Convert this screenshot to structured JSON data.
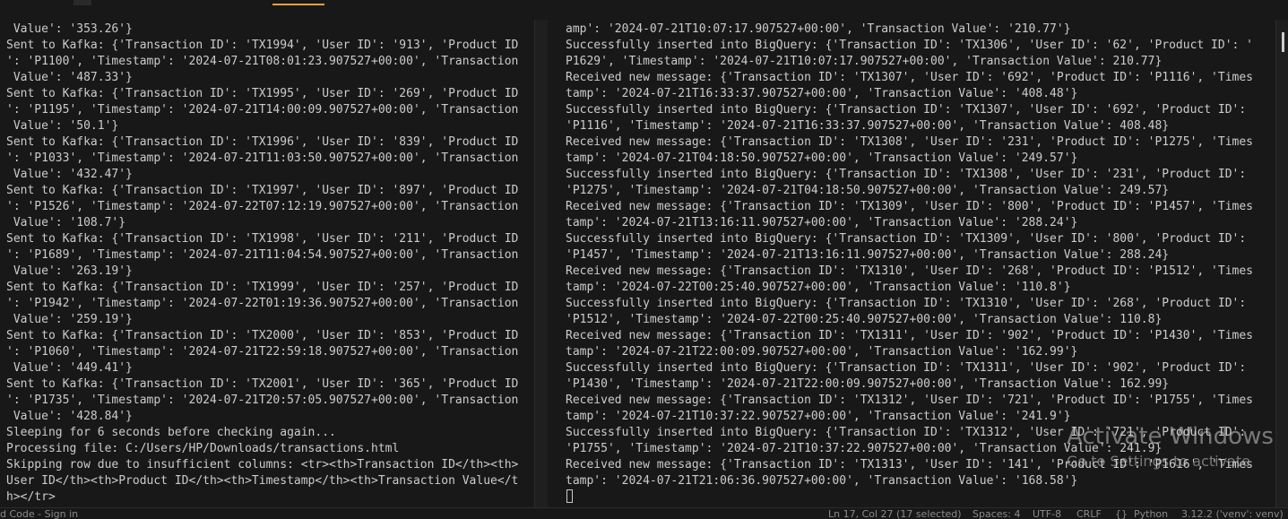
{
  "left_terminal": {
    "lines": [
      " Value': '353.26'}",
      "Sent to Kafka: {'Transaction ID': 'TX1994', 'User ID': '913', 'Product ID",
      "': 'P1100', 'Timestamp': '2024-07-21T08:01:23.907527+00:00', 'Transaction",
      " Value': '487.33'}",
      "Sent to Kafka: {'Transaction ID': 'TX1995', 'User ID': '269', 'Product ID",
      "': 'P1195', 'Timestamp': '2024-07-21T14:00:09.907527+00:00', 'Transaction",
      " Value': '50.1'}",
      "Sent to Kafka: {'Transaction ID': 'TX1996', 'User ID': '839', 'Product ID",
      "': 'P1033', 'Timestamp': '2024-07-21T11:03:50.907527+00:00', 'Transaction",
      " Value': '432.47'}",
      "Sent to Kafka: {'Transaction ID': 'TX1997', 'User ID': '897', 'Product ID",
      "': 'P1526', 'Timestamp': '2024-07-22T07:12:19.907527+00:00', 'Transaction",
      " Value': '108.7'}",
      "Sent to Kafka: {'Transaction ID': 'TX1998', 'User ID': '211', 'Product ID",
      "': 'P1689', 'Timestamp': '2024-07-21T11:04:54.907527+00:00', 'Transaction",
      " Value': '263.19'}",
      "Sent to Kafka: {'Transaction ID': 'TX1999', 'User ID': '257', 'Product ID",
      "': 'P1942', 'Timestamp': '2024-07-22T01:19:36.907527+00:00', 'Transaction",
      " Value': '259.19'}",
      "Sent to Kafka: {'Transaction ID': 'TX2000', 'User ID': '853', 'Product ID",
      "': 'P1060', 'Timestamp': '2024-07-21T22:59:18.907527+00:00', 'Transaction",
      " Value': '449.41'}",
      "Sent to Kafka: {'Transaction ID': 'TX2001', 'User ID': '365', 'Product ID",
      "': 'P1735', 'Timestamp': '2024-07-21T20:57:05.907527+00:00', 'Transaction",
      " Value': '428.84'}",
      "Sleeping for 6 seconds before checking again...",
      "Processing file: C:/Users/HP/Downloads/transactions.html",
      "Skipping row due to insufficient columns: <tr><th>Transaction ID</th><th>",
      "User ID</th><th>Product ID</th><th>Timestamp</th><th>Transaction Value</t",
      "h></tr>"
    ]
  },
  "right_terminal": {
    "lines": [
      "amp': '2024-07-21T10:07:17.907527+00:00', 'Transaction Value': '210.77'}",
      "Successfully inserted into BigQuery: {'Transaction ID': 'TX1306', 'User ID': '62', 'Product ID': '",
      "P1629', 'Timestamp': '2024-07-21T10:07:17.907527+00:00', 'Transaction Value': 210.77}",
      "Received new message: {'Transaction ID': 'TX1307', 'User ID': '692', 'Product ID': 'P1116', 'Times",
      "tamp': '2024-07-21T16:33:37.907527+00:00', 'Transaction Value': '408.48'}",
      "Successfully inserted into BigQuery: {'Transaction ID': 'TX1307', 'User ID': '692', 'Product ID':",
      "'P1116', 'Timestamp': '2024-07-21T16:33:37.907527+00:00', 'Transaction Value': 408.48}",
      "Received new message: {'Transaction ID': 'TX1308', 'User ID': '231', 'Product ID': 'P1275', 'Times",
      "tamp': '2024-07-21T04:18:50.907527+00:00', 'Transaction Value': '249.57'}",
      "Successfully inserted into BigQuery: {'Transaction ID': 'TX1308', 'User ID': '231', 'Product ID':",
      "'P1275', 'Timestamp': '2024-07-21T04:18:50.907527+00:00', 'Transaction Value': 249.57}",
      "Received new message: {'Transaction ID': 'TX1309', 'User ID': '800', 'Product ID': 'P1457', 'Times",
      "tamp': '2024-07-21T13:16:11.907527+00:00', 'Transaction Value': '288.24'}",
      "Successfully inserted into BigQuery: {'Transaction ID': 'TX1309', 'User ID': '800', 'Product ID':",
      "'P1457', 'Timestamp': '2024-07-21T13:16:11.907527+00:00', 'Transaction Value': 288.24}",
      "Received new message: {'Transaction ID': 'TX1310', 'User ID': '268', 'Product ID': 'P1512', 'Times",
      "tamp': '2024-07-22T00:25:40.907527+00:00', 'Transaction Value': '110.8'}",
      "Successfully inserted into BigQuery: {'Transaction ID': 'TX1310', 'User ID': '268', 'Product ID':",
      "'P1512', 'Timestamp': '2024-07-22T00:25:40.907527+00:00', 'Transaction Value': 110.8}",
      "Received new message: {'Transaction ID': 'TX1311', 'User ID': '902', 'Product ID': 'P1430', 'Times",
      "tamp': '2024-07-21T22:00:09.907527+00:00', 'Transaction Value': '162.99'}",
      "Successfully inserted into BigQuery: {'Transaction ID': 'TX1311', 'User ID': '902', 'Product ID':",
      "'P1430', 'Timestamp': '2024-07-21T22:00:09.907527+00:00', 'Transaction Value': 162.99}",
      "Received new message: {'Transaction ID': 'TX1312', 'User ID': '721', 'Product ID': 'P1755', 'Times",
      "tamp': '2024-07-21T10:37:22.907527+00:00', 'Transaction Value': '241.9'}",
      "Successfully inserted into BigQuery: {'Transaction ID': 'TX1312', 'User ID': '721', 'Product ID':",
      "'P1755', 'Timestamp': '2024-07-21T10:37:22.907527+00:00', 'Transaction Value': 241.9}",
      "Received new message: {'Transaction ID': 'TX1313', 'User ID': '141', 'Product ID': 'P1616', 'Times",
      "tamp': '2024-07-21T21:06:36.907527+00:00', 'Transaction Value': '168.58'}"
    ]
  },
  "watermark": {
    "title": "Activate Windows",
    "subtitle": "Go to Settings to activate"
  },
  "status_bar": {
    "left": "d Code - Sign in",
    "cursor_position": "Ln 17, Col 27 (17 selected)",
    "spaces": "Spaces: 4",
    "encoding": "UTF-8",
    "eol": "CRLF",
    "language_icon": "{}",
    "language": "Python",
    "interpreter": "3.12.2 ('venv': venv)"
  },
  "colors": {
    "background": "#181818",
    "text": "#cccccc",
    "accent": "#e7a23b"
  }
}
